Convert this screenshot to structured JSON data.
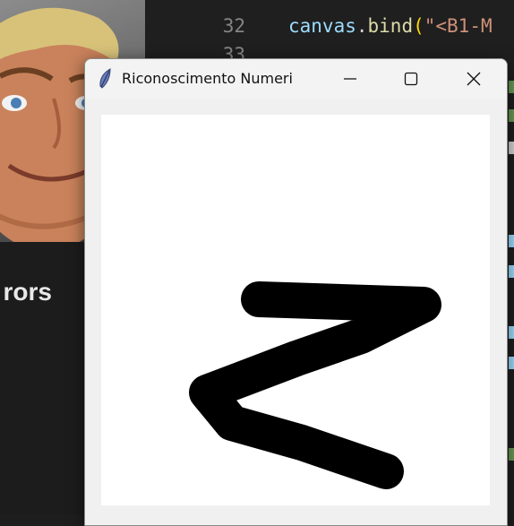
{
  "background": {
    "left_caption": "rors",
    "editor": {
      "lines": [
        {
          "number": "32",
          "tokens": [
            {
              "text": "canvas",
              "kind": "var"
            },
            {
              "text": ".",
              "kind": "punc"
            },
            {
              "text": "bind",
              "kind": "fn"
            },
            {
              "text": "(",
              "kind": "paren"
            },
            {
              "text": "\"<B1-M",
              "kind": "str"
            }
          ]
        },
        {
          "number": "33",
          "tokens": []
        }
      ]
    }
  },
  "window": {
    "title": "Riconoscimento Numeri",
    "icon": "feather-icon",
    "controls": {
      "minimize": "minimize-icon",
      "maximize": "maximize-icon",
      "close": "close-icon"
    },
    "canvas": {
      "background": "#ffffff",
      "stroke_color": "#000000",
      "drawn_digit": "2"
    }
  },
  "colors": {
    "editor_bg": "#1f1f1f",
    "window_bg": "#f0f0f0"
  }
}
